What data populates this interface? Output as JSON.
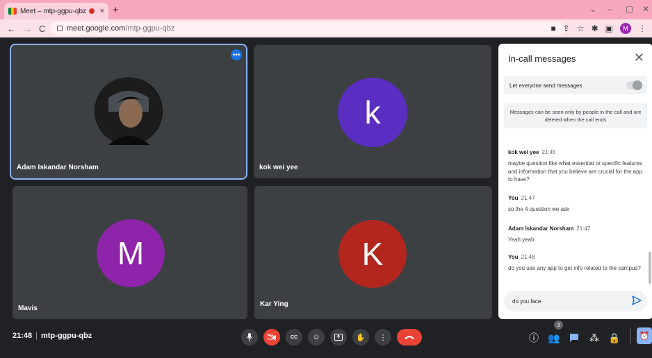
{
  "browser": {
    "tab_title": "Meet – mtp-ggpu-qbz",
    "tab_close": "×",
    "new_tab": "+",
    "url_domain": "meet.google.com",
    "url_path": "/mtp-ggpu-qbz",
    "profile_initial": "M",
    "window_controls": [
      "⌄",
      "–",
      "▢",
      "✕"
    ]
  },
  "tiles": [
    {
      "name": "Adam Iskandar Norsham",
      "initial": "",
      "color": "#000000",
      "active": true
    },
    {
      "name": "kok wei yee",
      "initial": "k",
      "color": "#5b2ec2"
    },
    {
      "name": "Mavis",
      "initial": "M",
      "color": "#8e24aa"
    },
    {
      "name": "Kar Ying",
      "initial": "K",
      "color": "#b3261e"
    }
  ],
  "chat": {
    "title": "In-call messages",
    "toggle_label": "Let everyone send messages",
    "info": "Messages can be seen only by people in the call and are deleted when the call ends",
    "messages": [
      {
        "sender": "kok wei yee",
        "time": "21:45",
        "text": "maybe question like what essential or specific features and information that you believe are crucial for the app to have?"
      },
      {
        "sender": "You",
        "time": "21:47",
        "text": "so the 4 question we ask"
      },
      {
        "sender": "Adam Iskandar Norsham",
        "time": "21:47",
        "text": "Yeah yeah"
      },
      {
        "sender": "You",
        "time": "21:48",
        "text": "do you use any app to get info related to the campus?"
      }
    ],
    "draft": "do you face"
  },
  "bottombar": {
    "time": "21:48",
    "meeting_code": "mtp-ggpu-qbz",
    "participants_count": "3"
  },
  "colors": {
    "accent": "#8ab4f8",
    "danger": "#ea4335",
    "background": "#202124",
    "tile": "#3c4043"
  }
}
